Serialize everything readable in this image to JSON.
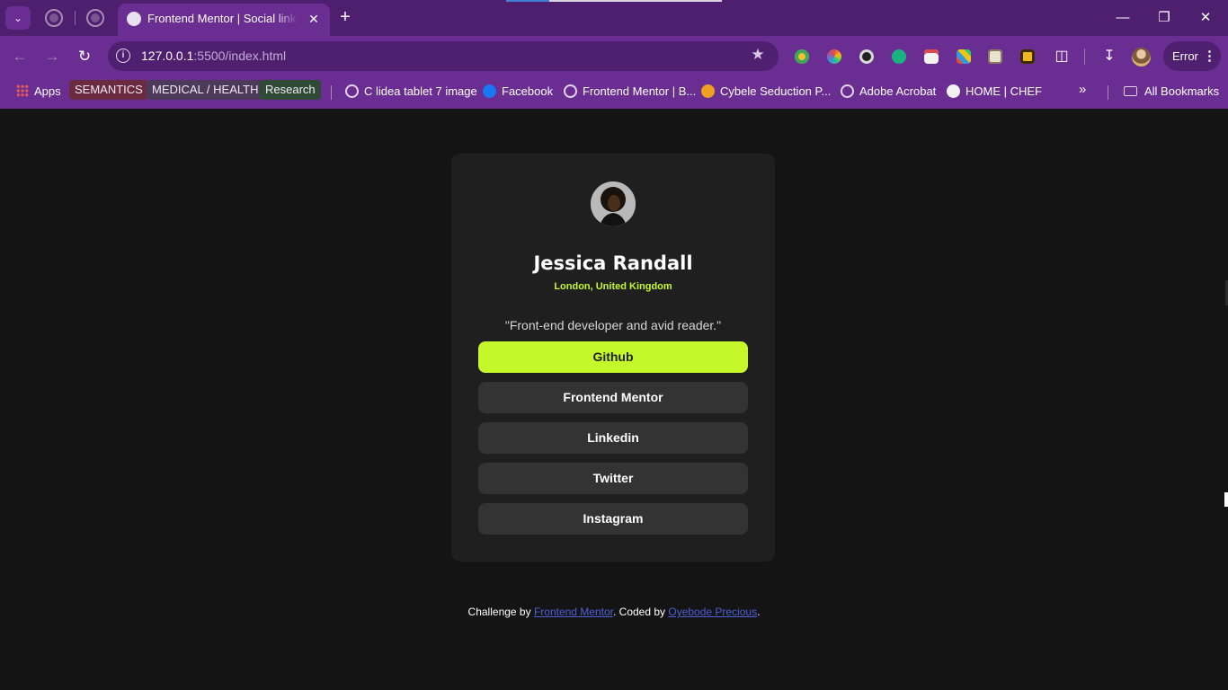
{
  "browser": {
    "active_tab_title": "Frontend Mentor | Social links profile",
    "url_host": "127.0.0.1",
    "url_path": ":5500/index.html",
    "profile_status": "Error",
    "bookmarks": {
      "apps": "Apps",
      "chips": [
        {
          "label": "SEMANTICS",
          "color": "#6b2b3f"
        },
        {
          "label": "MEDICAL / HEALTH",
          "color": "#4b3a59"
        },
        {
          "label": "Research",
          "color": "#2f4a35"
        }
      ],
      "links": [
        {
          "label": "C lidea tablet 7 image",
          "icon": "globe-icon"
        },
        {
          "label": "Facebook",
          "icon": "facebook-icon"
        },
        {
          "label": "Frontend Mentor | B...",
          "icon": "globe-icon"
        },
        {
          "label": "Cybele Seduction P...",
          "icon": "star-badge-icon"
        },
        {
          "label": "Adobe Acrobat",
          "icon": "globe-icon"
        },
        {
          "label": "HOME | CHEF",
          "icon": "chef-icon"
        }
      ],
      "all_bookmarks": "All Bookmarks"
    }
  },
  "profile": {
    "name": "Jessica Randall",
    "location": "London, United Kingdom",
    "bio": "\"Front-end developer and avid reader.\"",
    "links": [
      {
        "label": "Github",
        "primary": true
      },
      {
        "label": "Frontend Mentor",
        "primary": false
      },
      {
        "label": "Linkedin",
        "primary": false
      },
      {
        "label": "Twitter",
        "primary": false
      },
      {
        "label": "Instagram",
        "primary": false
      }
    ]
  },
  "attribution": {
    "prefix": "Challenge by ",
    "challenge_link": "Frontend Mentor",
    "middle": ". Coded by ",
    "author_link": "Oyebode Precious",
    "suffix": "."
  },
  "colors": {
    "accent": "#c4f82a",
    "card": "#1f1f1f",
    "page": "#141414",
    "button": "#333333",
    "browser_frame": "#6a2d91"
  }
}
